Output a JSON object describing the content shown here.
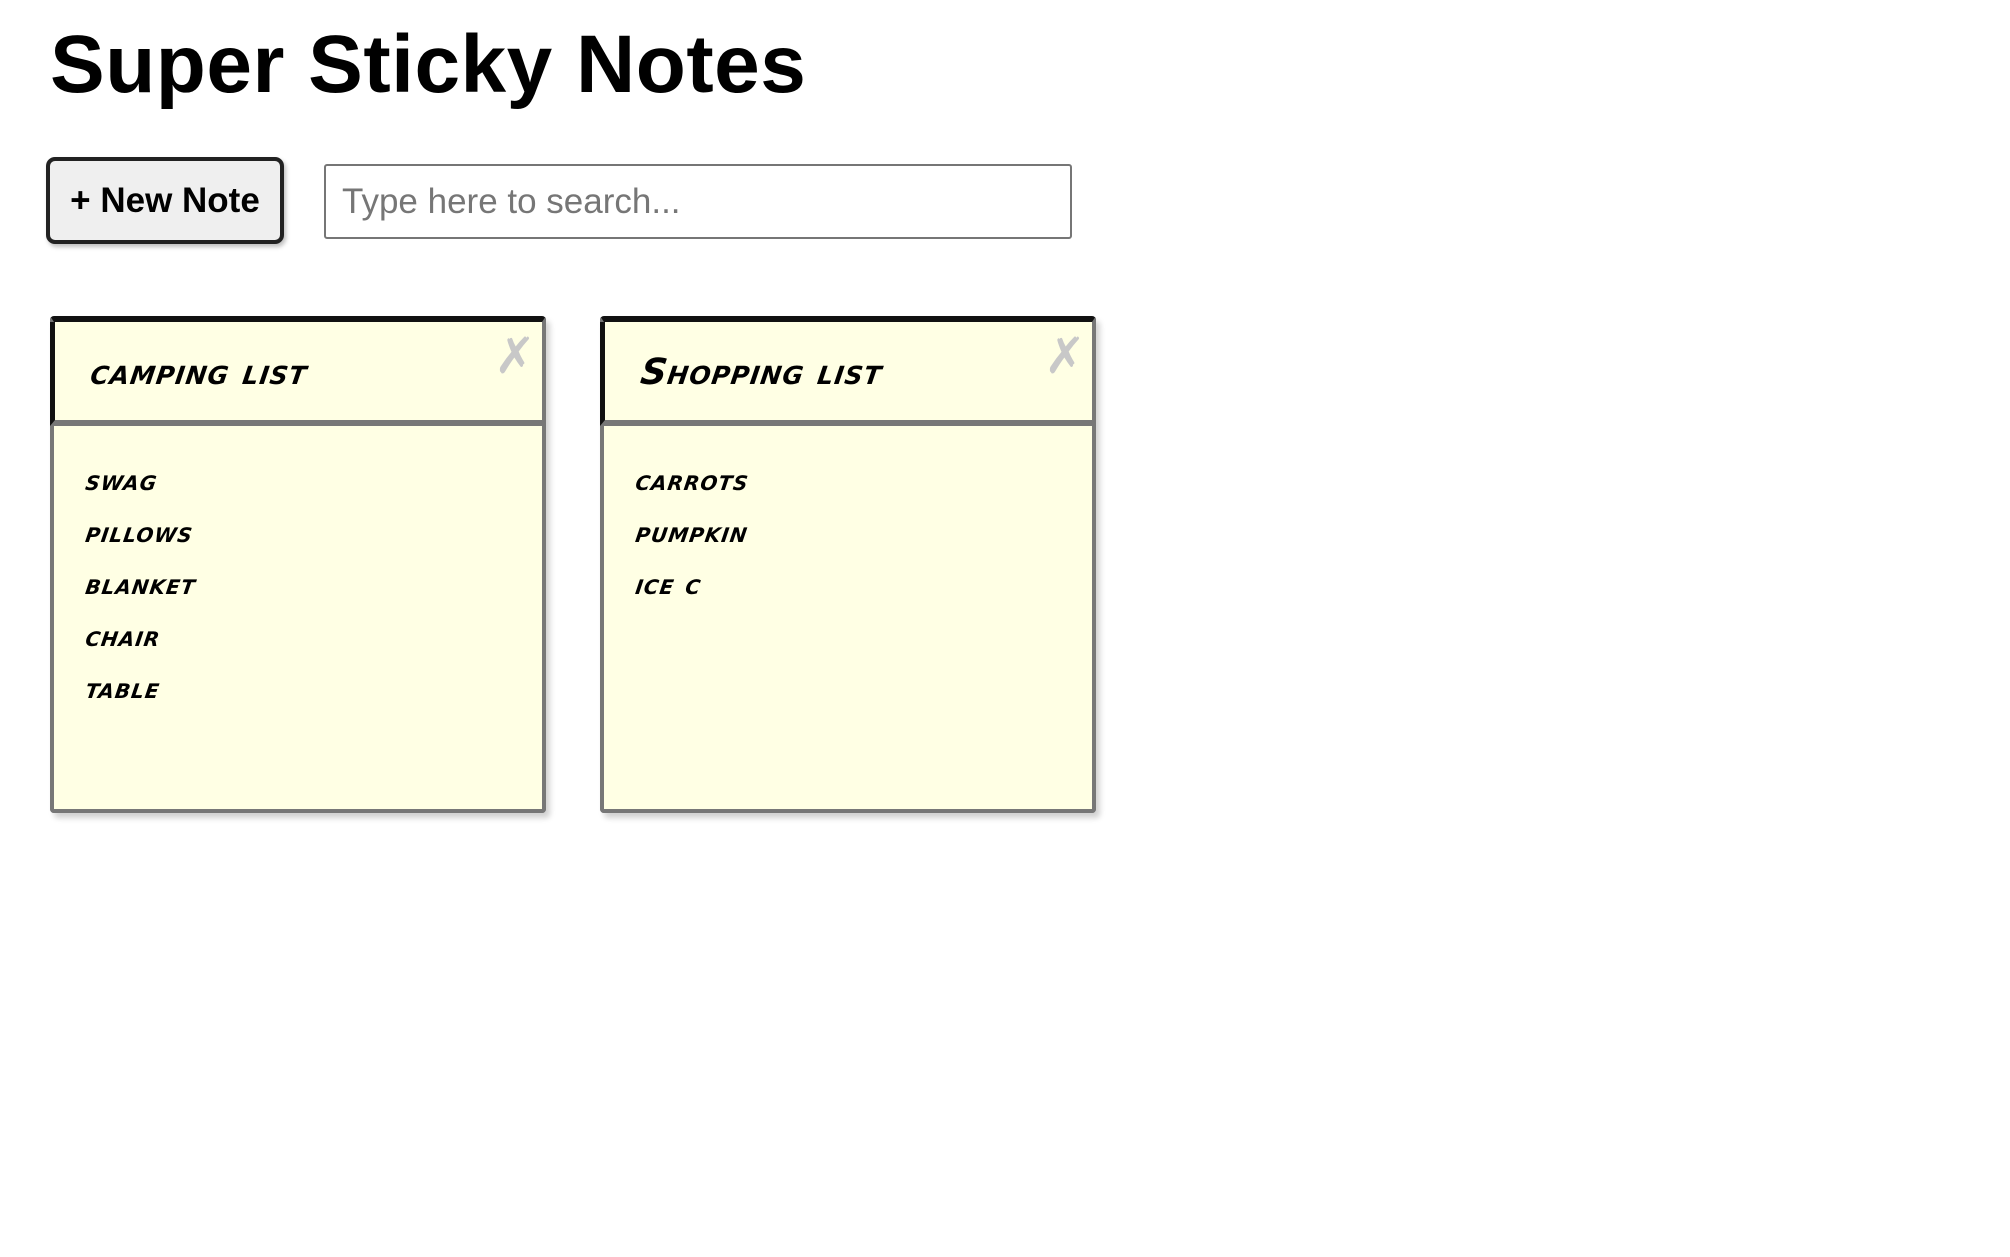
{
  "header": {
    "title": "Super Sticky Notes"
  },
  "toolbar": {
    "new_note_label": "+ New Note",
    "search_placeholder": "Type here to search..."
  },
  "notes": [
    {
      "title": "camping list",
      "close_icon": "close-icon",
      "items": [
        "swag",
        "pillows",
        "blanket",
        "chair",
        "table"
      ]
    },
    {
      "title": "Shopping list",
      "close_icon": "close-icon",
      "items": [
        "carrots",
        "pumpkin",
        "ice c"
      ]
    }
  ],
  "colors": {
    "note_background": "#ffffe4",
    "close_icon": "#c8c8c8"
  }
}
